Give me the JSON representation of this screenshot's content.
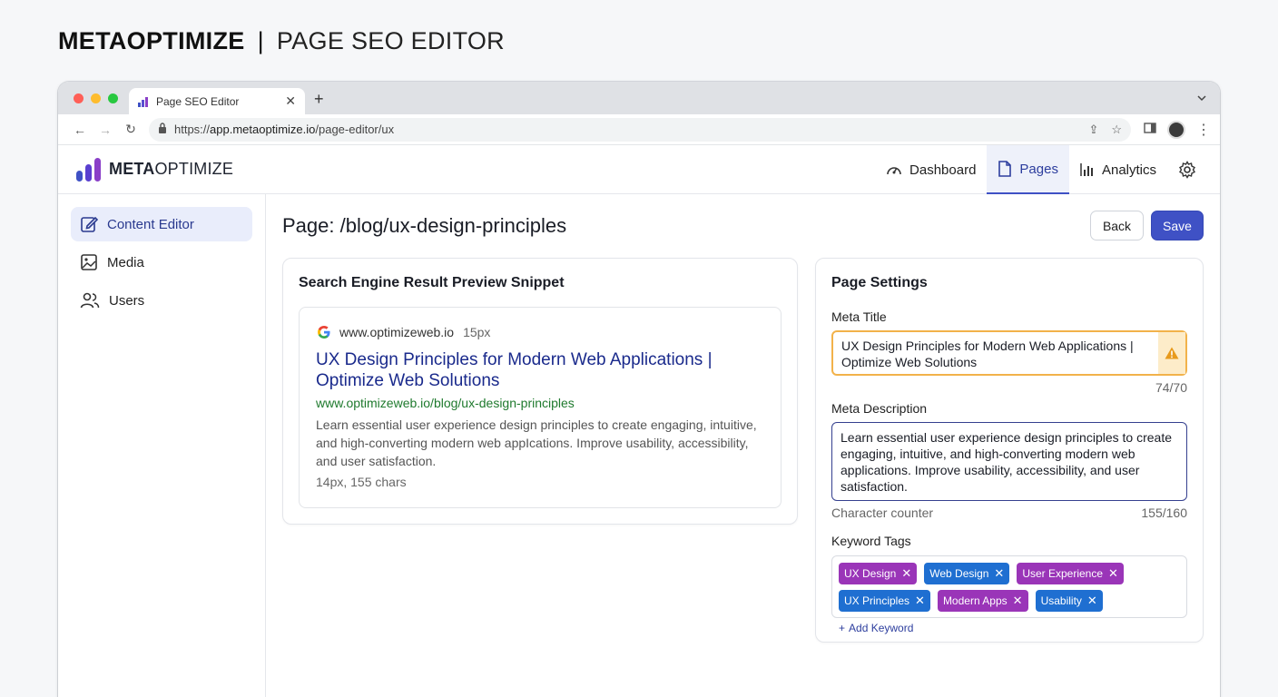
{
  "heading": {
    "brand": "METAOPTIMIZE",
    "separator": "|",
    "subtitle": "PAGE SEO EDITOR"
  },
  "browser": {
    "tab_title": "Page SEO Editor",
    "url": "https://app.metaoptimize.io/page-editor/ux",
    "url_domain": "app.metaoptimize.io",
    "url_scheme": "https://",
    "url_path": "/page-editor/ux"
  },
  "app": {
    "logo_bold": "META",
    "logo_rest": "OPTIMIZE",
    "nav": [
      {
        "label": "Dashboard",
        "icon": "speedometer-icon"
      },
      {
        "label": "Pages",
        "icon": "document-icon",
        "active": true
      },
      {
        "label": "Analytics",
        "icon": "bar-chart-icon"
      }
    ]
  },
  "sidebar": {
    "items": [
      {
        "label": "Content Editor",
        "icon": "edit-icon",
        "active": true
      },
      {
        "label": "Media",
        "icon": "image-icon"
      },
      {
        "label": "Users",
        "icon": "users-icon"
      }
    ]
  },
  "main": {
    "page_title": "Page: /blog/ux-design-principles",
    "back_label": "Back",
    "save_label": "Save"
  },
  "preview": {
    "card_title": "Search Engine Result Preview Snippet",
    "site": "www.optimizeweb.io",
    "site_size": "15px",
    "title": "UX Design Principles for Modern Web Applications | Optimize Web Solutions",
    "url": "www.optimizeweb.io/blog/ux-design-principles",
    "description": "Learn essential user experience design principles to create engaging, intuitive, and high-converting modern web appIcations. Improve usability, accessibility, and user satisfaction.",
    "meta": "14px, 155 chars"
  },
  "settings": {
    "card_title": "Page Settings",
    "meta_title_label": "Meta Title",
    "meta_title_value": "UX Design Principles for Modern Web Applications | Optimize Web Solutions",
    "meta_title_counter": "74/70",
    "meta_desc_label": "Meta Description",
    "meta_desc_value": "Learn essential user experience design principles to create engaging, intuitive, and high-converting modern web applications. Improve usability, accessibility, and user satisfaction.",
    "char_counter_label": "Character counter",
    "char_counter_value": "155/160",
    "keyword_label": "Keyword Tags",
    "tags": [
      {
        "label": "UX Design",
        "color": "#9a35b8"
      },
      {
        "label": "Web Design",
        "color": "#1f6fd1"
      },
      {
        "label": "User Experience",
        "color": "#9a35b8"
      },
      {
        "label": "UX Principles",
        "color": "#1f6fd1"
      },
      {
        "label": "Modern Apps",
        "color": "#9a35b8"
      },
      {
        "label": "Usability",
        "color": "#1f6fd1"
      }
    ],
    "add_keyword_label": "Add Keyword"
  },
  "colors": {
    "accent": "#3f51c5",
    "warning": "#f2b24a",
    "link": "#1a2a8c",
    "url_green": "#1f7a2e"
  }
}
